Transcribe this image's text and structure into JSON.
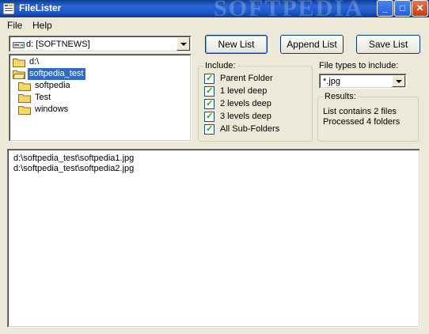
{
  "window": {
    "title": "FileLister",
    "watermark": "SOFTPEDIA"
  },
  "menu": {
    "file": "File",
    "help": "Help"
  },
  "drive": {
    "value": "d: [SOFTNEWS]"
  },
  "tree": {
    "root": "d:\\",
    "items": [
      {
        "label": "softpedia_test",
        "selected": true
      },
      {
        "label": "softpedia",
        "selected": false
      },
      {
        "label": "Test",
        "selected": false
      },
      {
        "label": "windows",
        "selected": false
      }
    ]
  },
  "buttons": {
    "new_list": "New List",
    "append_list": "Append List",
    "save_list": "Save List"
  },
  "include": {
    "title": "Include:",
    "options": [
      {
        "label": "Parent Folder",
        "checked": true
      },
      {
        "label": "1 level deep",
        "checked": true
      },
      {
        "label": "2 levels deep",
        "checked": true
      },
      {
        "label": "3 levels deep",
        "checked": true
      },
      {
        "label": "All Sub-Folders",
        "checked": true
      }
    ]
  },
  "file_types": {
    "label": "File types to include:",
    "value": "*.jpg"
  },
  "results": {
    "title": "Results:",
    "line1": "List contains 2 files",
    "line2": "Processed 4 folders"
  },
  "file_list": [
    "d:\\softpedia_test\\softpedia1.jpg",
    "d:\\softpedia_test\\softpedia2.jpg"
  ],
  "colors": {
    "title_bar": "#245edb",
    "selection": "#316ac5",
    "face": "#ece9d8"
  }
}
